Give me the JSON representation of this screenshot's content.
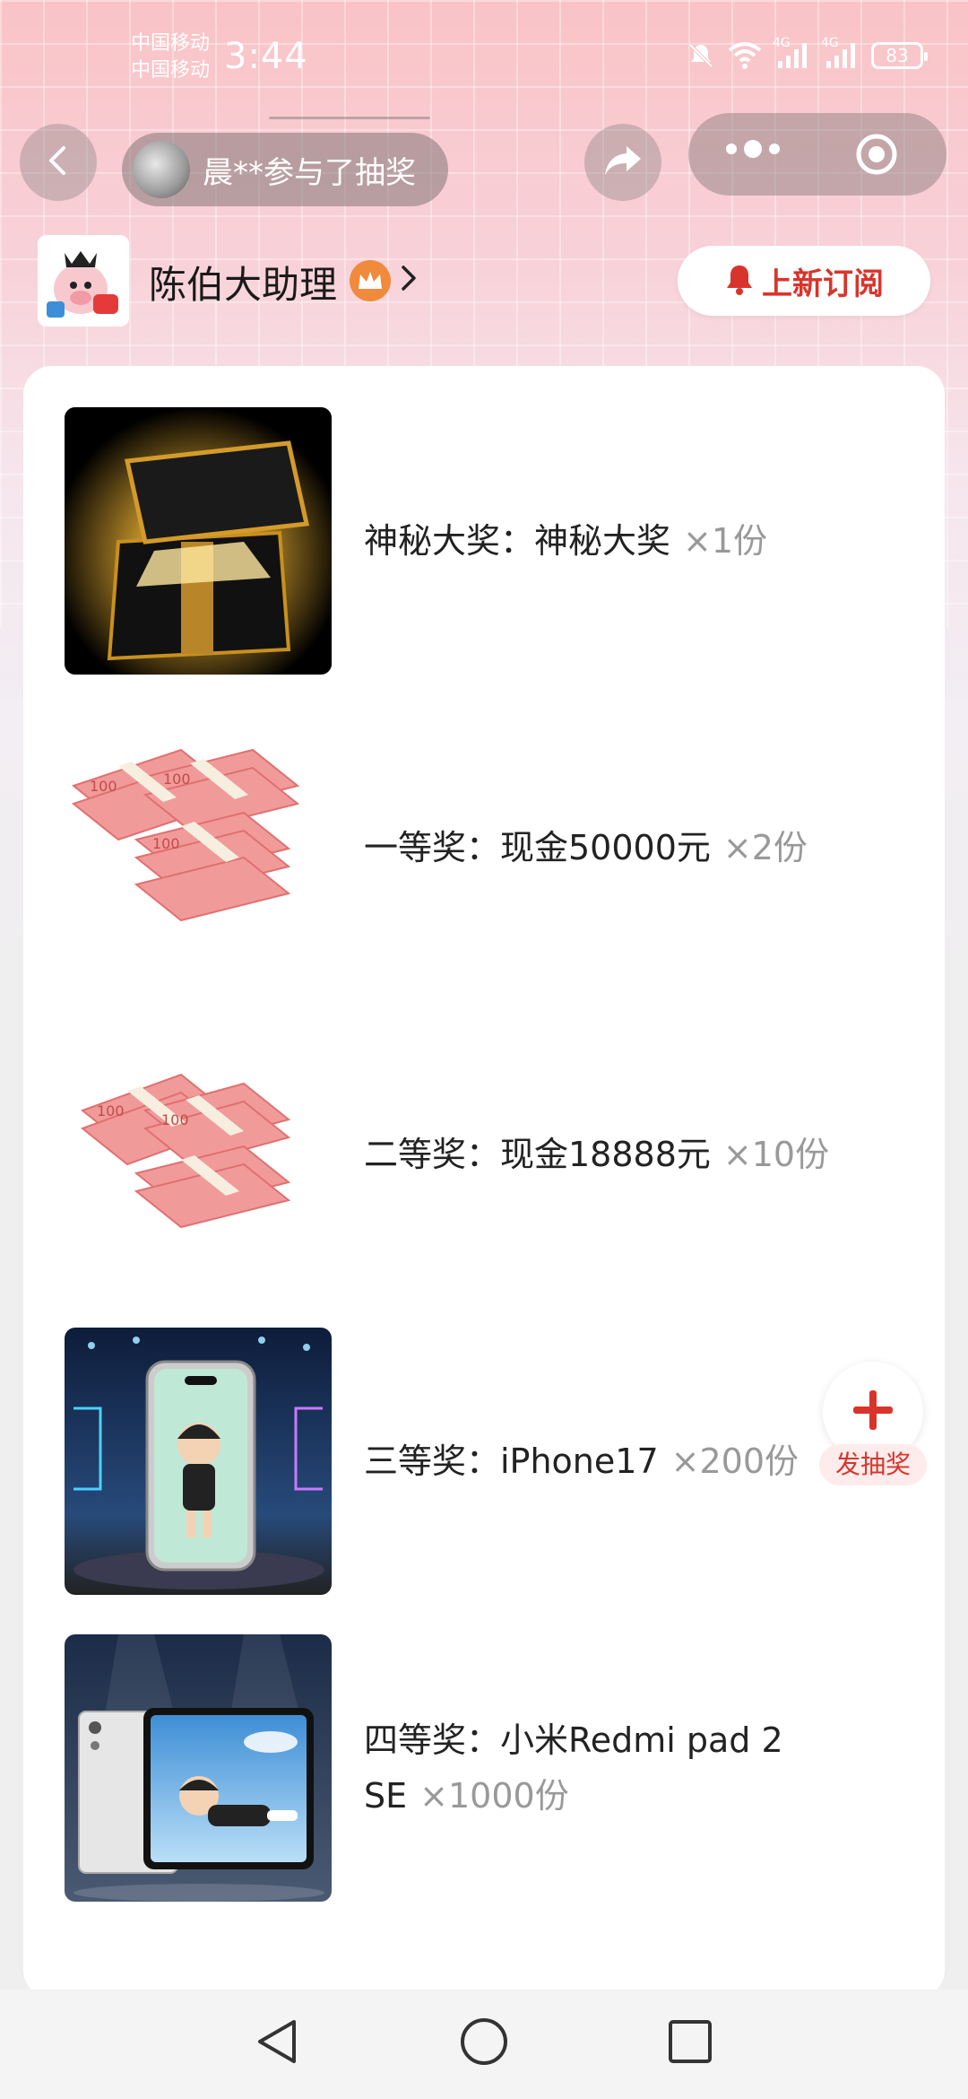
{
  "status_bar": {
    "carrier_1": "中国移动",
    "carrier_2": "中国移动",
    "time": "3:44",
    "network_1": "4G",
    "network_2": "4G",
    "battery": "83"
  },
  "header": {
    "ticker_text": "晨**参与了抽奖"
  },
  "account": {
    "name": "陈伯大助理",
    "subscribe_label": "上新订阅"
  },
  "prizes": [
    {
      "label": "神秘大奖：神秘大奖",
      "qty": "×1份",
      "image": "mystery-gift-box"
    },
    {
      "label": "一等奖：现金50000元",
      "qty": "×2份",
      "image": "cash-stacks"
    },
    {
      "label": "二等奖：现金18888元",
      "qty": "×10份",
      "image": "cash-stacks"
    },
    {
      "label": "三等奖：iPhone17",
      "qty": "×200份",
      "image": "iphone"
    },
    {
      "label": "四等奖：小米Redmi pad 2 SE",
      "qty": "×1000份",
      "image": "tablet"
    }
  ],
  "fab": {
    "label": "发抽奖"
  },
  "colors": {
    "accent": "#d9342b",
    "badge": "#f08a3c"
  }
}
